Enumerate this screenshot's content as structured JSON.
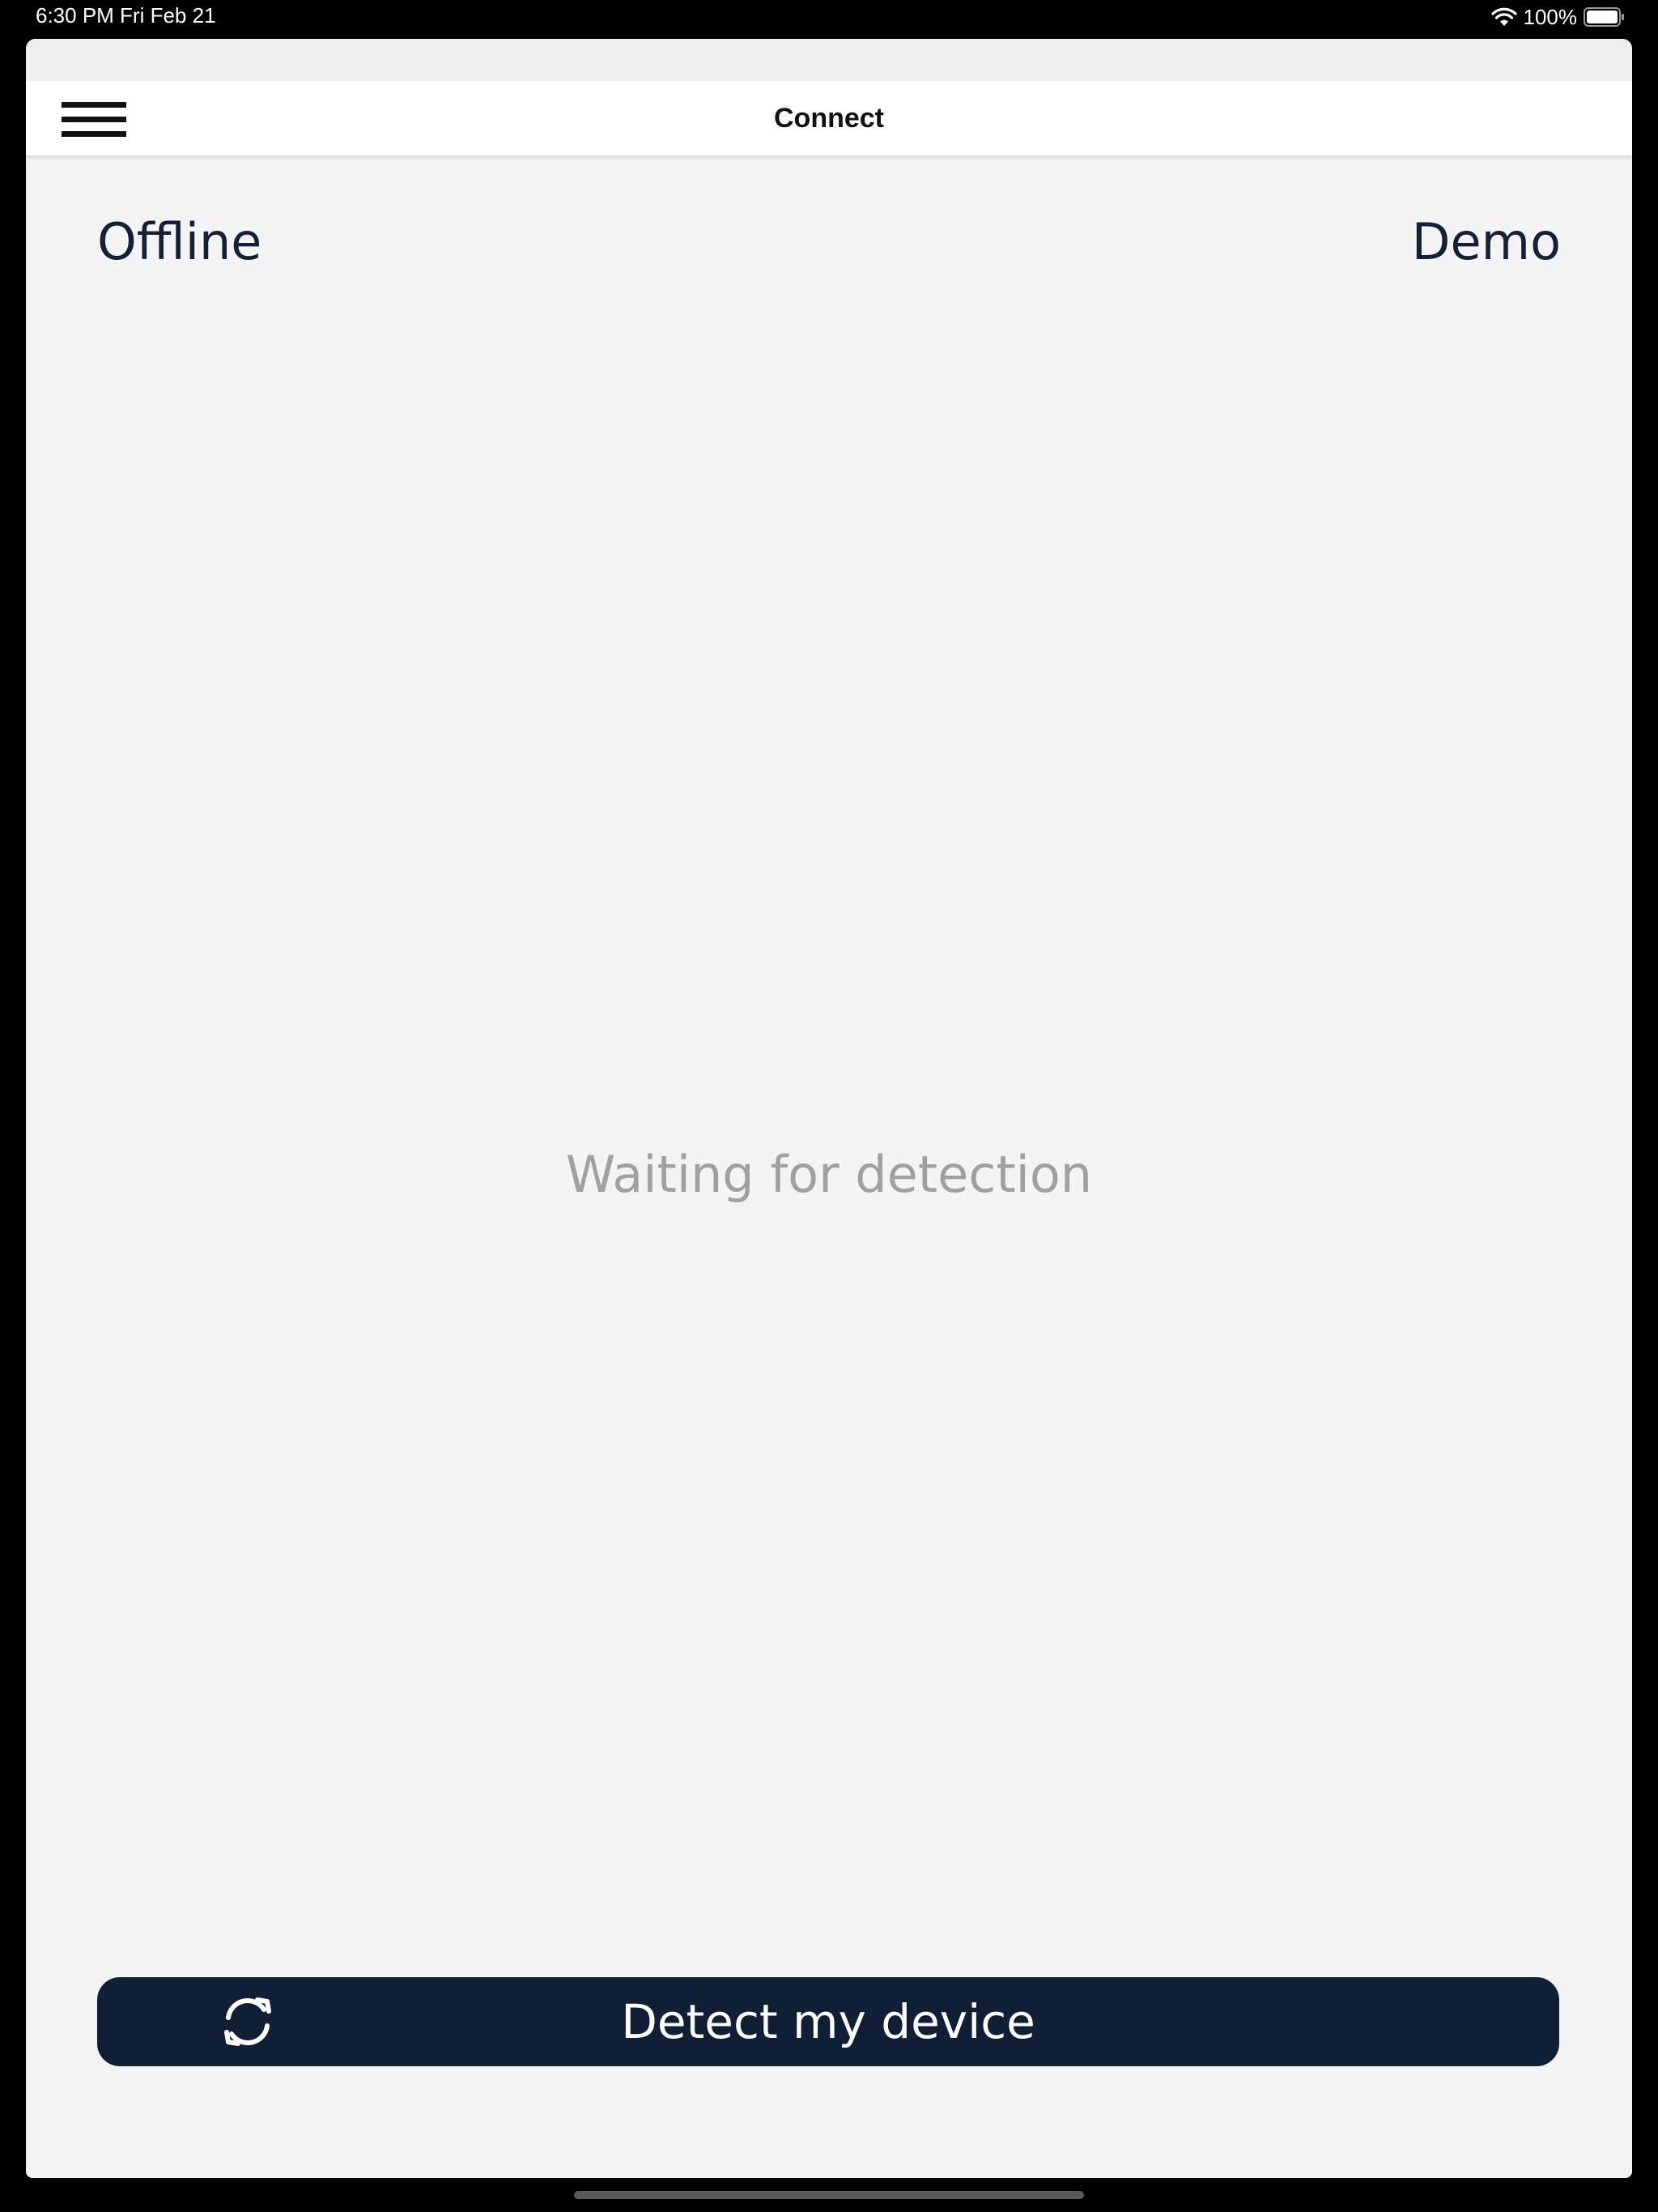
{
  "status_bar": {
    "time_date": "6:30 PM   Fri Feb 21",
    "battery_text": "100%",
    "wifi_icon": "wifi-icon",
    "battery_icon": "battery-full-icon"
  },
  "nav": {
    "title": "Connect",
    "menu_icon": "hamburger-menu-icon"
  },
  "modes": {
    "offline_label": "Offline",
    "demo_label": "Demo"
  },
  "main": {
    "waiting_text": "Waiting for detection"
  },
  "detect_button": {
    "label": "Detect my device",
    "icon": "refresh-icon"
  },
  "colors": {
    "brand_navy": "#101f36",
    "text_navy": "#132038",
    "muted_text": "#a0a0a0",
    "background": "#f4f4f4"
  }
}
